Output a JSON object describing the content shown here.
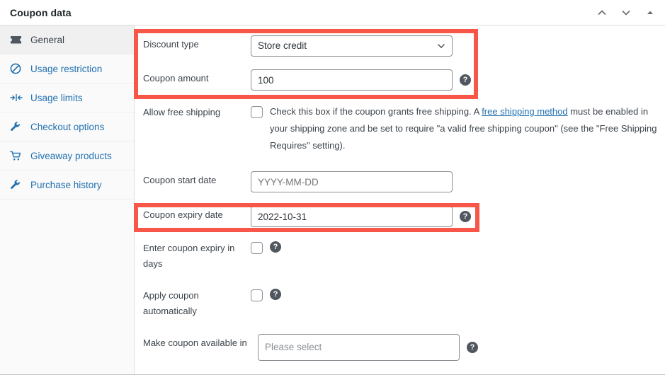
{
  "header": {
    "title": "Coupon data",
    "controls": [
      {
        "name": "move-up-icon",
        "label": "Move up"
      },
      {
        "name": "move-down-icon",
        "label": "Move down"
      },
      {
        "name": "toggle-panel-icon",
        "label": "Toggle panel"
      }
    ]
  },
  "sidebar": {
    "items": [
      {
        "label": "General",
        "icon": "ticket-icon",
        "active": true
      },
      {
        "label": "Usage restriction",
        "icon": "no-entry-icon",
        "active": false
      },
      {
        "label": "Usage limits",
        "icon": "usage-limits-icon",
        "active": false
      },
      {
        "label": "Checkout options",
        "icon": "wrench-icon",
        "active": false
      },
      {
        "label": "Giveaway products",
        "icon": "cart-icon",
        "active": false
      },
      {
        "label": "Purchase history",
        "icon": "wrench-icon",
        "active": false
      }
    ]
  },
  "fields": {
    "discount_type": {
      "label": "Discount type",
      "value": "Store credit",
      "options": [
        "Store credit"
      ]
    },
    "coupon_amount": {
      "label": "Coupon amount",
      "value": "100",
      "help": "?"
    },
    "allow_free_shipping": {
      "label": "Allow free shipping",
      "checked": false,
      "desc_before": "Check this box if the coupon grants free shipping. A ",
      "desc_link": "free shipping method",
      "desc_after": " must be enabled in your shipping zone and be set to require \"a valid free shipping coupon\" (see the \"Free Shipping Requires\" setting)."
    },
    "coupon_start_date": {
      "label": "Coupon start date",
      "value": "",
      "placeholder": "YYYY-MM-DD"
    },
    "coupon_expiry_date": {
      "label": "Coupon expiry date",
      "value": "2022-10-31",
      "placeholder": "YYYY-MM-DD",
      "help": "?"
    },
    "expiry_in_days": {
      "label": "Enter coupon expiry in days",
      "checked": false,
      "help": "?"
    },
    "apply_automatically": {
      "label": "Apply coupon automatically",
      "checked": false,
      "help": "?"
    },
    "make_available_in": {
      "label": "Make coupon available in",
      "value": "",
      "placeholder": "Please select",
      "help": "?"
    }
  },
  "highlights": {
    "color": "#f9564a",
    "regions": [
      {
        "name": "discount-section-highlight"
      },
      {
        "name": "expiry-date-highlight"
      }
    ]
  }
}
